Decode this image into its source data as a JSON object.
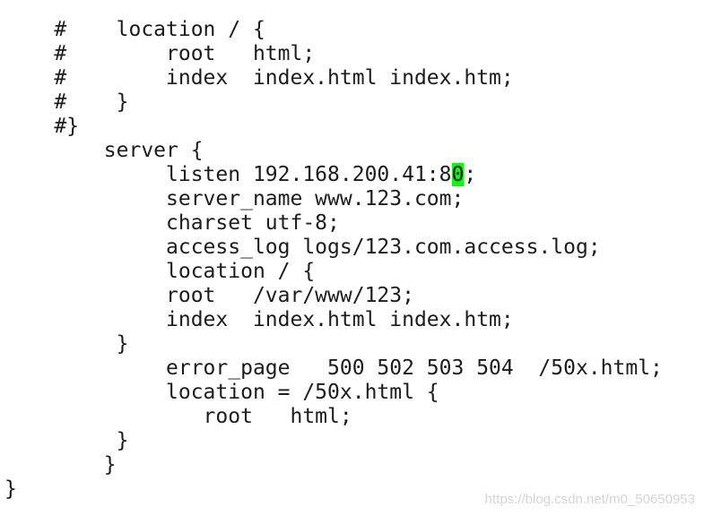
{
  "terminal": {
    "lines": [
      "    #    location / {",
      "    #        root   html;",
      "    #        index  index.html index.htm;",
      "    #    }",
      "    #}",
      "        server {",
      "             listen 192.168.200.41:8",
      "             server_name www.123.com;",
      "             charset utf-8;",
      "             access_log logs/123.com.access.log;",
      "             location / {",
      "             root   /var/www/123;",
      "             index  index.html index.htm;",
      "         }",
      "             error_page   500 502 503 504  /50x.html;",
      "             location = /50x.html {",
      "                root   html;",
      "         }",
      "        }",
      "}"
    ],
    "cursor_char": "0",
    "cursor_after": ";",
    "cursor_color": "#00ff00"
  },
  "watermark": "https://blog.csdn.net/m0_50650953"
}
